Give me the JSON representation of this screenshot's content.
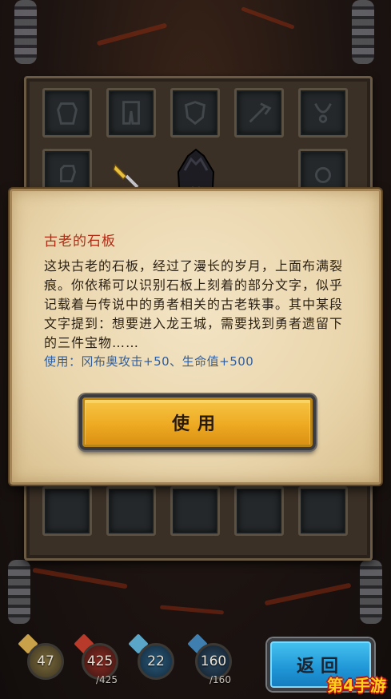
{
  "dialog": {
    "title": "古老的石板",
    "description": "这块古老的石板，经过了漫长的岁月，上面布满裂痕。你依稀可以识别石板上刻着的部分文字，似乎记载着与传说中的勇者相关的古老轶事。其中某段文字提到：想要进入龙王城，需要找到勇者遗留下的三件宝物……",
    "effect": "使用：冈布奥攻击+50、生命值+500",
    "use_button": "使用"
  },
  "hud": {
    "attack": "47",
    "hp": "425",
    "hp_max": "/425",
    "mana": "22",
    "gold": "160",
    "gold_max": "/160",
    "back_button": "返回"
  },
  "colors": {
    "title_red": "#b02a14",
    "effect_blue": "#2f5fa0",
    "use_button_gold": "#eeaa22",
    "back_button_blue": "#1f95d6"
  },
  "watermark": "第4手游"
}
